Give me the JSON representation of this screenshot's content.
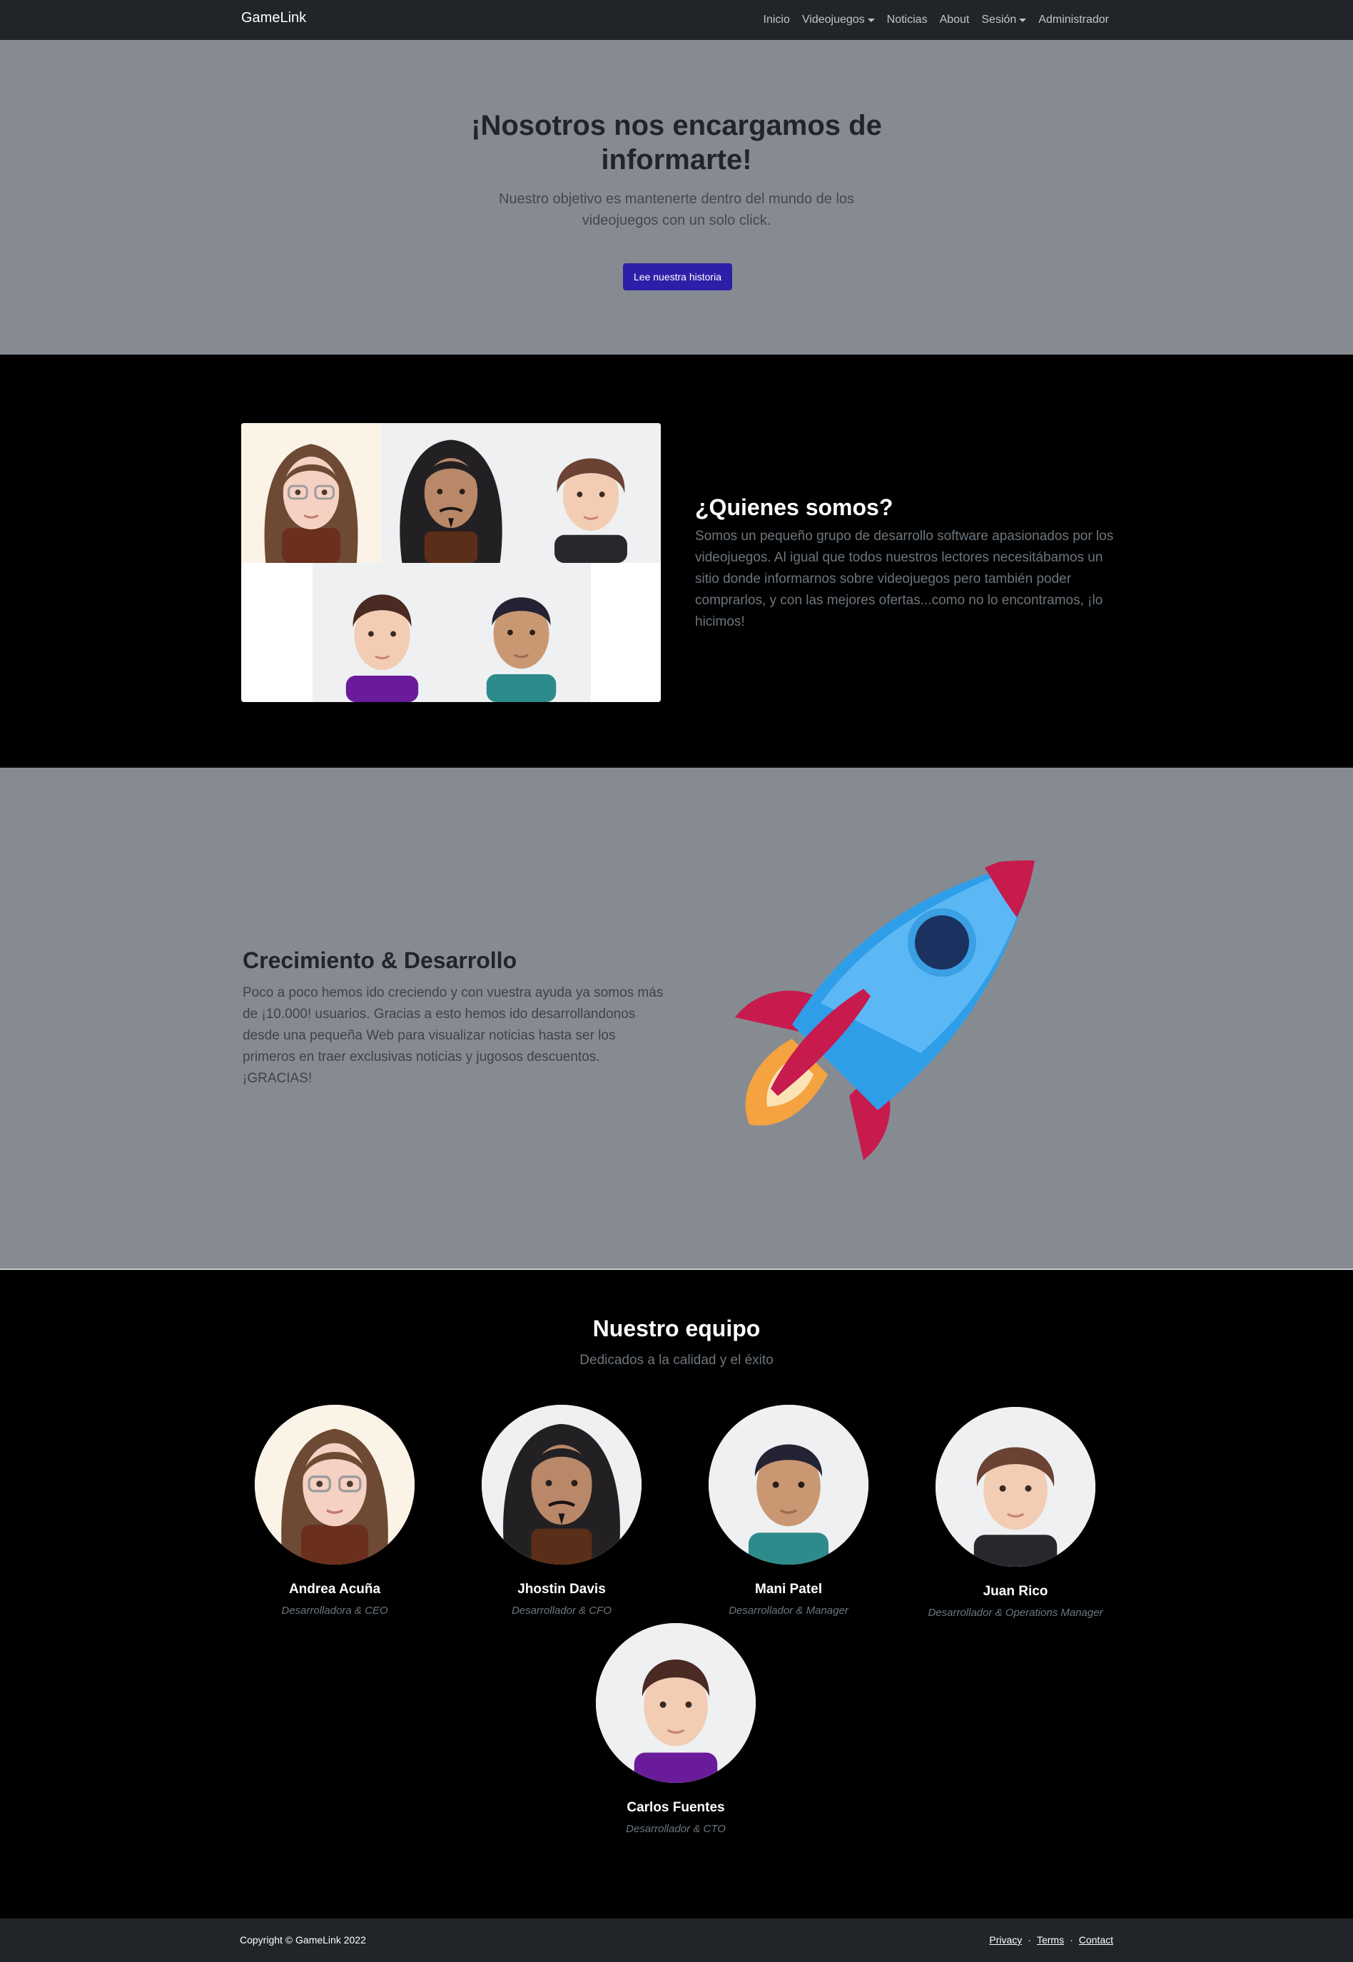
{
  "nav": {
    "brand": "GameLink",
    "links": [
      {
        "label": "Inicio"
      },
      {
        "label": "Videojuegos",
        "dropdown": true
      },
      {
        "label": "Noticias"
      },
      {
        "label": "About"
      },
      {
        "label": "Sesión",
        "dropdown": true
      },
      {
        "label": "Administrador"
      }
    ]
  },
  "hero": {
    "title": "¡Nosotros nos encargamos de informarte!",
    "subtitle": "Nuestro objetivo es mantenerte dentro del mundo de los videojuegos con un solo click.",
    "button": "Lee nuestra historia"
  },
  "about": {
    "title": "¿Quienes somos?",
    "text": "Somos un pequeño grupo de desarrollo software apasionados por los videojuegos. Al igual que todos nuestros lectores necesitábamos un sitio donde informarnos sobre videojuegos pero también poder comprarlos, y con las mejores ofertas...como no lo encontramos, ¡lo hicimos!"
  },
  "growth": {
    "title": "Crecimiento & Desarrollo",
    "text": "Poco a poco hemos ido creciendo y con vuestra ayuda ya somos más de ¡10.000! usuarios. Gracias a esto hemos ido desarrollandonos desde una pequeña Web para visualizar noticias hasta ser los primeros en traer exclusivas noticias y jugosos descuentos. ¡GRACIAS!"
  },
  "team": {
    "title": "Nuestro equipo",
    "subtitle": "Dedicados a la calidad y el éxito",
    "members": [
      {
        "name": "Andrea Acuña",
        "role": "Desarrolladora & CEO"
      },
      {
        "name": "Jhostin Davis",
        "role": "Desarrollador & CFO"
      },
      {
        "name": "Mani Patel",
        "role": "Desarrollador & Manager"
      },
      {
        "name": "Juan Rico",
        "role": "Desarrollador & Operations Manager"
      },
      {
        "name": "Carlos Fuentes",
        "role": "Desarrollador & CTO"
      }
    ]
  },
  "footer": {
    "copyright": "Copyright © GameLink 2022",
    "links": [
      "Privacy",
      "Terms",
      "Contact"
    ],
    "separator": "·"
  },
  "colors": {
    "navbar": "#212529",
    "hero_bg": "#868b92",
    "section_dark": "#000000",
    "button": "#2e1fa8",
    "muted_text": "#6c757d"
  }
}
